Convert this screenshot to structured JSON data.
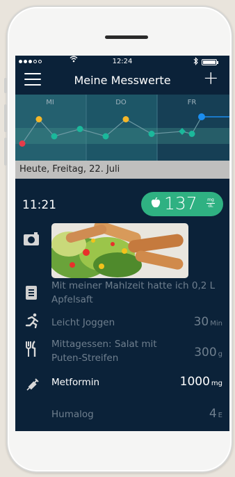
{
  "status_bar": {
    "time": "12:24"
  },
  "navbar": {
    "title": "Meine Messwerte"
  },
  "chart_data": {
    "type": "line",
    "categories": [
      "MI",
      "DO",
      "FR"
    ],
    "title": "",
    "xlabel": "",
    "ylabel": "",
    "series": [
      {
        "values": [
          0.25,
          0.75,
          0.4,
          0.55,
          0.4,
          0.75,
          0.45,
          0.5,
          0.45,
          0.8
        ],
        "point_colors": [
          "#e63c4a",
          "#f5b729",
          "#1bb89b",
          "#1bb89b",
          "#1bb89b",
          "#f5b729",
          "#1bb89b",
          "#1bb89b",
          "#1bb89b",
          "#1b8ef0"
        ]
      }
    ],
    "grid": false,
    "legend": "none"
  },
  "date_bar": {
    "label": "Heute, Freitag, 22. Juli"
  },
  "entry": {
    "time": "11:21",
    "glucose": {
      "value": "137",
      "unit_top": "mg",
      "unit_bottom": "dL",
      "color": "#2fb182"
    },
    "note": "Mit meiner Mahlzeit hatte ich 0,2 L Apfelsaft",
    "activities": [
      {
        "label": "Leicht Joggen",
        "amount": "30",
        "unit": "Min"
      },
      {
        "label": "Mittagessen: Salat mit Puten-Streifen",
        "amount": "300",
        "unit": "g"
      },
      {
        "label": "Metformin",
        "amount": "1000",
        "unit": "mg"
      },
      {
        "label": "Humalog",
        "amount": "4",
        "unit": "E"
      }
    ]
  },
  "colors": {
    "screen_bg": "#0b2239",
    "chart_bg": "#1c5464",
    "accent_blue": "#1b8ef0",
    "muted_text": "#6f7f8e"
  }
}
